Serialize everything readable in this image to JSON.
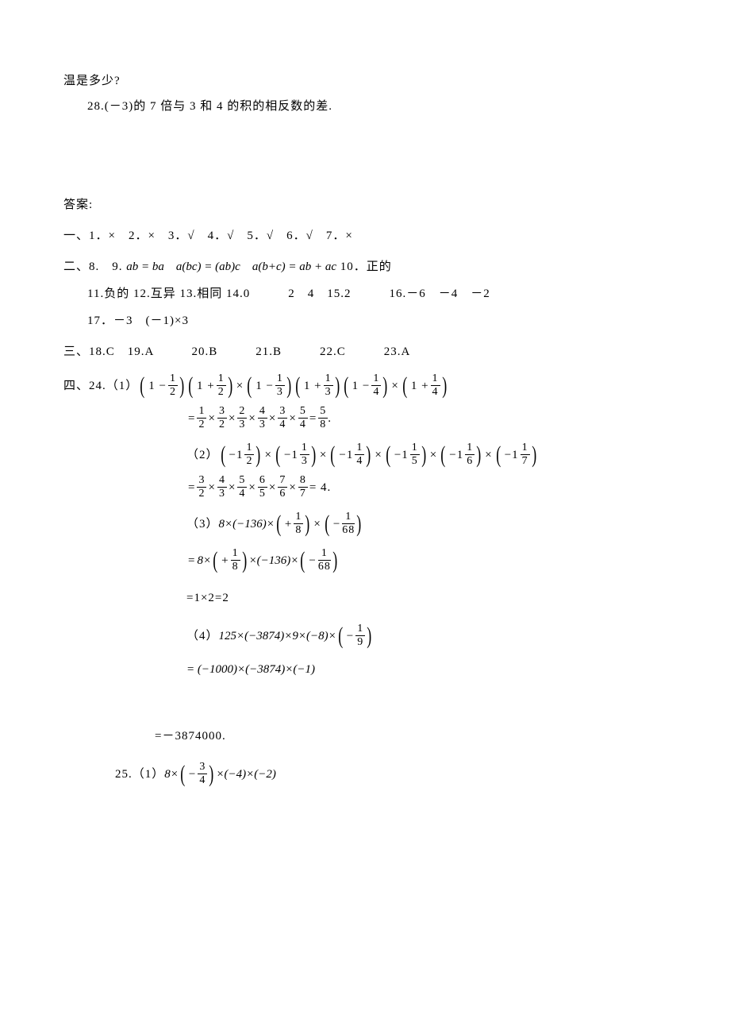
{
  "header": {
    "line1": "温是多少?",
    "q28": "28.(－3)的 7 倍与 3 和 4 的积的相反数的差."
  },
  "answers_title": "答案:",
  "section1": {
    "label": "一、",
    "items": "1．×　2．×　3．√　4．√　5．√　6．√　7．×"
  },
  "section2": {
    "label": "二、",
    "line1_prefix": "8.　9.",
    "line1_math": "ab = ba　a(bc) = (ab)c　a(b+c) = ab + ac",
    "line1_suffix": "10．正的",
    "line2": "11.负的 12.互异 13.相同 14.0　　　2　4　15.2　　　16.－6　－4　－2",
    "line3": "17．－3　(－1)×3"
  },
  "section3": {
    "label": "三、",
    "items": "18.C　19.A　　　20.B　　　21.B　　　22.C　　　23.A"
  },
  "section4": {
    "label": "四、",
    "q24": {
      "label_1": "24.（1）",
      "expr1_parts": [
        {
          "type": "paren",
          "inner": [
            {
              "text": "1 −"
            },
            {
              "frac": [
                "1",
                "2"
              ]
            }
          ]
        },
        {
          "type": "paren",
          "inner": [
            {
              "text": "1 +"
            },
            {
              "frac": [
                "1",
                "2"
              ]
            }
          ]
        },
        {
          "type": "times"
        },
        {
          "type": "paren",
          "inner": [
            {
              "text": "1 −"
            },
            {
              "frac": [
                "1",
                "3"
              ]
            }
          ]
        },
        {
          "type": "paren",
          "inner": [
            {
              "text": "1 +"
            },
            {
              "frac": [
                "1",
                "3"
              ]
            }
          ]
        },
        {
          "type": "paren",
          "inner": [
            {
              "text": "1 −"
            },
            {
              "frac": [
                "1",
                "4"
              ]
            }
          ]
        },
        {
          "type": "times"
        },
        {
          "type": "paren",
          "inner": [
            {
              "text": "1 +"
            },
            {
              "frac": [
                "1",
                "4"
              ]
            }
          ]
        }
      ],
      "expr1_result_prefix": "=",
      "expr1_result_fracs": [
        [
          "1",
          "2"
        ],
        [
          "3",
          "2"
        ],
        [
          "2",
          "3"
        ],
        [
          "4",
          "3"
        ],
        [
          "3",
          "4"
        ],
        [
          "5",
          "4"
        ]
      ],
      "expr1_result_tail": "=",
      "expr1_final": [
        "5",
        "8"
      ],
      "expr1_period": ".",
      "label_2": "（2）",
      "expr2_parts": [
        {
          "type": "paren",
          "inner": [
            {
              "text": "−1"
            },
            {
              "frac": [
                "1",
                "2"
              ]
            }
          ]
        },
        {
          "type": "times"
        },
        {
          "type": "paren",
          "inner": [
            {
              "text": "−1"
            },
            {
              "frac": [
                "1",
                "3"
              ]
            }
          ]
        },
        {
          "type": "times"
        },
        {
          "type": "paren",
          "inner": [
            {
              "text": "−1"
            },
            {
              "frac": [
                "1",
                "4"
              ]
            }
          ]
        },
        {
          "type": "times"
        },
        {
          "type": "paren",
          "inner": [
            {
              "text": "−1"
            },
            {
              "frac": [
                "1",
                "5"
              ]
            }
          ]
        },
        {
          "type": "times"
        },
        {
          "type": "paren",
          "inner": [
            {
              "text": "−1"
            },
            {
              "frac": [
                "1",
                "6"
              ]
            }
          ]
        },
        {
          "type": "times"
        },
        {
          "type": "paren",
          "inner": [
            {
              "text": "−1"
            },
            {
              "frac": [
                "1",
                "7"
              ]
            }
          ]
        }
      ],
      "expr2_result_prefix": "=",
      "expr2_result_fracs": [
        [
          "3",
          "2"
        ],
        [
          "4",
          "3"
        ],
        [
          "5",
          "4"
        ],
        [
          "6",
          "5"
        ],
        [
          "7",
          "6"
        ],
        [
          "8",
          "7"
        ]
      ],
      "expr2_result_tail": "= 4.",
      "label_3": "（3）",
      "expr3_line1_head": "8×(−136)×",
      "expr3_line1_p1": [
        "1",
        "8"
      ],
      "expr3_line1_p1_sign": "+",
      "expr3_line1_p2": [
        "1",
        "68"
      ],
      "expr3_line1_p2_sign": "−",
      "expr3_line2_eq": "=",
      "expr3_line2_head": "8×",
      "expr3_line2_p1_sign": "+",
      "expr3_line2_p1": [
        "1",
        "8"
      ],
      "expr3_line2_mid": "×(−136)×",
      "expr3_line2_p2_sign": "−",
      "expr3_line2_p2": [
        "1",
        "68"
      ],
      "expr3_line3": "=1×2=2",
      "label_4": "（4）",
      "expr4_line1_head": "125×(−3874)×9×(−8)×",
      "expr4_line1_p1_sign": "−",
      "expr4_line1_p1": [
        "1",
        "9"
      ],
      "expr4_line2": "= (−1000)×(−3874)×(−1)",
      "expr4_line3": "=－3874000."
    },
    "q25": {
      "label": "25.（1）",
      "head": "8×",
      "p1_sign": "−",
      "p1": [
        "3",
        "4"
      ],
      "tail": "×(−4)×(−2)"
    }
  }
}
